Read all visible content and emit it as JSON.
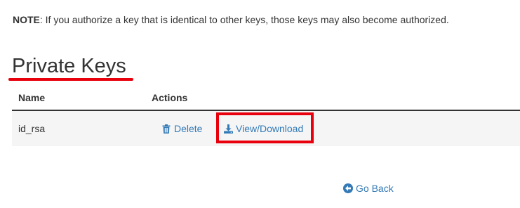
{
  "note": {
    "label": "NOTE",
    "text": ": If you authorize a key that is identical to other keys, those keys may also become authorized."
  },
  "section": {
    "title": "Private Keys"
  },
  "table": {
    "headers": [
      "Name",
      "Actions"
    ],
    "rows": [
      {
        "name": "id_rsa",
        "delete_label": "Delete",
        "download_label": "View/Download"
      }
    ]
  },
  "footer": {
    "go_back_label": "Go Back"
  },
  "icons": {
    "delete": "trash-icon",
    "download": "download-icon",
    "go_back": "arrow-circle-left-icon"
  },
  "colors": {
    "link": "#337ab7",
    "highlight": "#e8000d",
    "row_bg": "#f5f5f5",
    "text": "#333333"
  }
}
